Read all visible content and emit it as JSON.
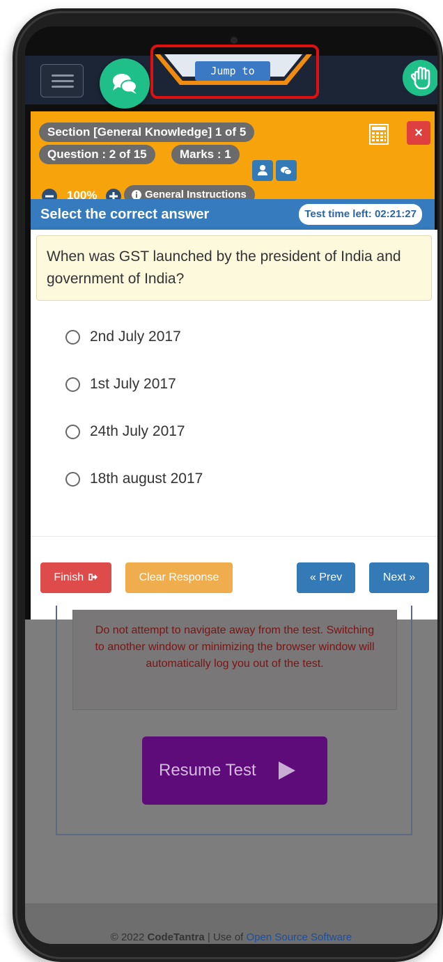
{
  "nav": {
    "jump_label": "Jump to"
  },
  "header": {
    "section": "Section [General Knowledge] 1 of 5",
    "question": "Question : 2 of 15",
    "marks": "Marks : 1",
    "zoom": "100%",
    "instructions": "General Instructions",
    "close": "×"
  },
  "instruction_bar": {
    "title": "Select the correct answer",
    "timer": "Test time left: 02:21:27"
  },
  "question": {
    "text": "When was GST launched by the president of India and government of India?",
    "options": [
      "2nd July 2017",
      "1st July 2017",
      "24th July 2017",
      "18th august 2017"
    ]
  },
  "actions": {
    "finish": "Finish",
    "clear": "Clear Response",
    "prev": "« Prev",
    "next": "Next »"
  },
  "overlay": {
    "warning": "Do not attempt to navigate away from the test. Switching to another window or minimizing the browser window will automatically log you out of the test.",
    "resume": "Resume Test",
    "footer_prefix": "© 2022",
    "footer_brand": "CodeTantra",
    "footer_sep": "| Use of",
    "footer_link": "Open Source Software"
  },
  "colors": {
    "header_bg": "#f7a30b",
    "instr_bg": "#357bbd",
    "fab_green": "#1fbf8a",
    "highlight": "#e01010",
    "finish": "#de4b4b",
    "clear": "#f0ad4e",
    "nav_btn": "#337ab7",
    "resume": "#5d0c7a"
  }
}
